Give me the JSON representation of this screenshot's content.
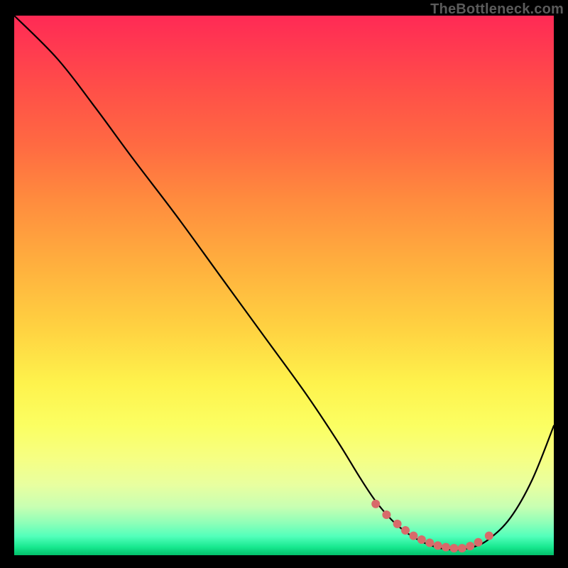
{
  "watermark": "TheBottleneck.com",
  "chart_data": {
    "type": "line",
    "title": "",
    "xlabel": "",
    "ylabel": "",
    "xlim": [
      0,
      100
    ],
    "ylim": [
      0,
      100
    ],
    "grid": false,
    "legend": false,
    "curve": {
      "x": [
        0,
        8,
        15,
        22,
        30,
        38,
        46,
        54,
        60,
        64,
        67,
        70,
        73,
        76,
        79,
        82,
        85,
        88,
        92,
        96,
        100
      ],
      "y": [
        100,
        92,
        83,
        73.5,
        63,
        52,
        41,
        30,
        21,
        14.5,
        10,
        6.5,
        4,
        2.3,
        1.3,
        1,
        1.5,
        3,
        7,
        14,
        24
      ]
    },
    "markers": {
      "x": [
        67,
        69,
        71,
        72.5,
        74,
        75.5,
        77,
        78.5,
        80,
        81.5,
        83,
        84.5,
        86,
        88
      ],
      "y": [
        9.5,
        7.5,
        5.8,
        4.6,
        3.6,
        2.9,
        2.3,
        1.8,
        1.5,
        1.3,
        1.3,
        1.7,
        2.4,
        3.6
      ],
      "color": "#d86a6a",
      "radius": 6
    },
    "line_color": "#000000",
    "line_width": 2.2,
    "background_gradient": {
      "direction": "vertical",
      "stops": [
        {
          "pos": 0.0,
          "color": "#ff2a55"
        },
        {
          "pos": 0.5,
          "color": "#ffc240"
        },
        {
          "pos": 0.78,
          "color": "#fbff62"
        },
        {
          "pos": 1.0,
          "color": "#02c06a"
        }
      ]
    }
  }
}
